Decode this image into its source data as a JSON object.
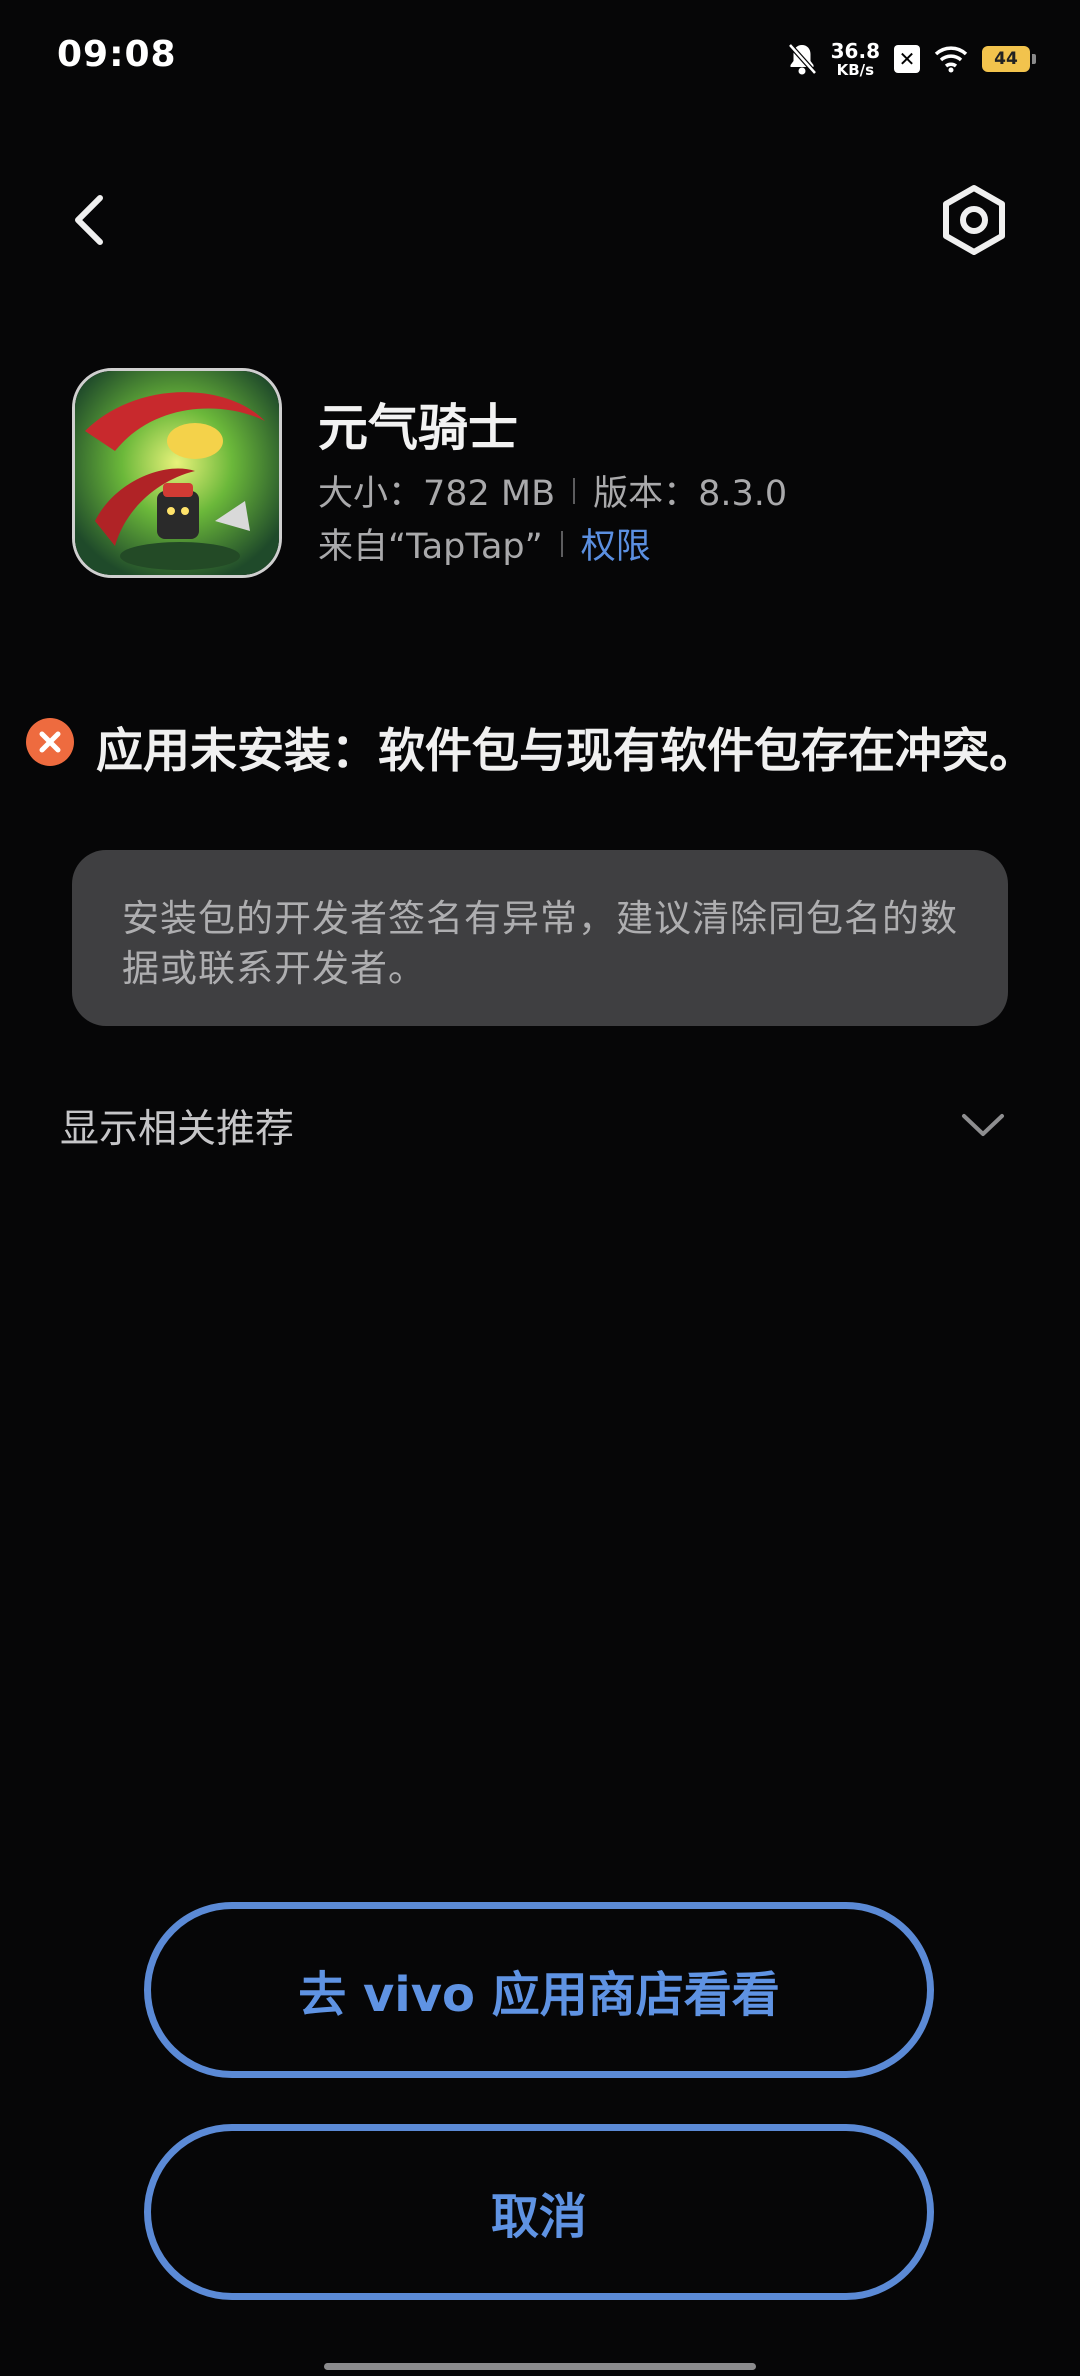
{
  "status_bar": {
    "time": "09:08",
    "net_speed_value": "36.8",
    "net_speed_unit": "KB/s",
    "battery": "44",
    "icons": [
      "bell-off-icon",
      "close-box-icon",
      "wifi-icon",
      "battery-icon"
    ]
  },
  "header": {
    "back_icon": "chevron-left-icon",
    "settings_icon": "hex-settings-icon"
  },
  "app": {
    "name": "元气骑士",
    "size": "大小：782 MB",
    "version": "版本：8.3.0",
    "source": "来自“TapTap”",
    "permissions_link": "权限"
  },
  "error": {
    "icon": "error-circle-icon",
    "message": "应用未安装：软件包与现有软件包存在冲突。",
    "color": "#ee6b3f"
  },
  "info_card": {
    "text": "安装包的开发者签名有异常，建议清除同包名的数据或联系开发者。"
  },
  "related": {
    "label": "显示相关推荐",
    "icon": "chevron-down-icon"
  },
  "actions": {
    "store_button": "去 vivo 应用商店看看",
    "cancel_button": "取消"
  },
  "colors": {
    "accent": "#5b8ad6",
    "background": "#060607",
    "card": "#3f3f41"
  }
}
